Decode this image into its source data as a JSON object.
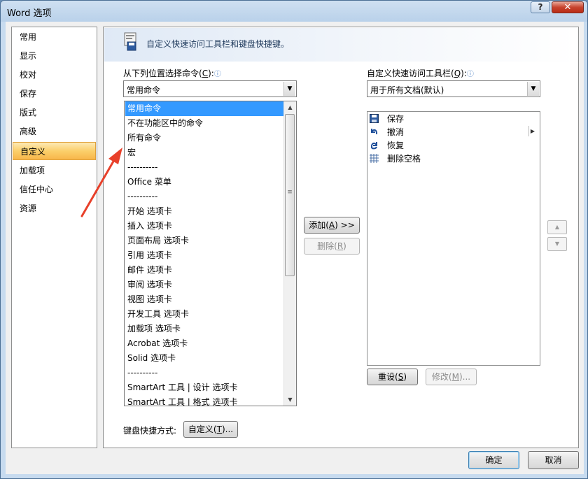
{
  "window": {
    "title": "Word 选项",
    "help": "?",
    "close": "✕"
  },
  "nav": {
    "items": [
      {
        "label": "常用",
        "selected": false
      },
      {
        "label": "显示",
        "selected": false
      },
      {
        "label": "校对",
        "selected": false
      },
      {
        "label": "保存",
        "selected": false
      },
      {
        "label": "版式",
        "selected": false
      },
      {
        "label": "高级",
        "selected": false
      },
      {
        "label": "自定义",
        "selected": true
      },
      {
        "label": "加载项",
        "selected": false
      },
      {
        "label": "信任中心",
        "selected": false
      },
      {
        "label": "资源",
        "selected": false
      }
    ]
  },
  "header": {
    "text": "自定义快速访问工具栏和键盘快捷键。",
    "icon": "toolbar-document-icon"
  },
  "left": {
    "label": "从下列位置选择命令(",
    "label_key": "C",
    "label_end": "):",
    "info": "ⓘ",
    "combo_value": "常用命令"
  },
  "dropdown": {
    "items": [
      "常用命令",
      "不在功能区中的命令",
      "所有命令",
      "宏",
      "----------",
      "Office 菜单",
      "----------",
      "开始 选项卡",
      "插入 选项卡",
      "页面布局 选项卡",
      "引用 选项卡",
      "邮件 选项卡",
      "审阅 选项卡",
      "视图 选项卡",
      "开发工具 选项卡",
      "加载项 选项卡",
      "Acrobat 选项卡",
      "Solid 选项卡",
      "----------",
      "SmartArt 工具 | 设计 选项卡",
      "SmartArt 工具 | 格式 选项卡"
    ],
    "highlighted": 0
  },
  "right": {
    "label": "自定义快速访问工具栏(",
    "label_key": "Q",
    "label_end": "):",
    "info": "ⓘ",
    "combo_value": "用于所有文档(默认)",
    "items": [
      {
        "label": "保存",
        "icon": "save-icon"
      },
      {
        "label": "撤消",
        "icon": "undo-icon"
      },
      {
        "label": "恢复",
        "icon": "redo-icon"
      },
      {
        "label": "删除空格",
        "icon": "grid-icon"
      }
    ]
  },
  "buttons": {
    "add": "添加(",
    "add_key": "A",
    "add_end": ") >>",
    "remove": "删除(",
    "remove_key": "R",
    "remove_end": ")",
    "reset": "重设(",
    "reset_key": "S",
    "reset_end": ")",
    "modify": "修改(",
    "modify_key": "M",
    "modify_end": ")...",
    "shortcut_label": "键盘快捷方式:",
    "customize": "自定义(",
    "customize_key": "T",
    "customize_end": ")...",
    "ok": "确定",
    "cancel": "取消"
  },
  "colors": {
    "selection": "#3399ff",
    "nav_selected": "#fbcf6a",
    "annotation": "#e8402a"
  }
}
